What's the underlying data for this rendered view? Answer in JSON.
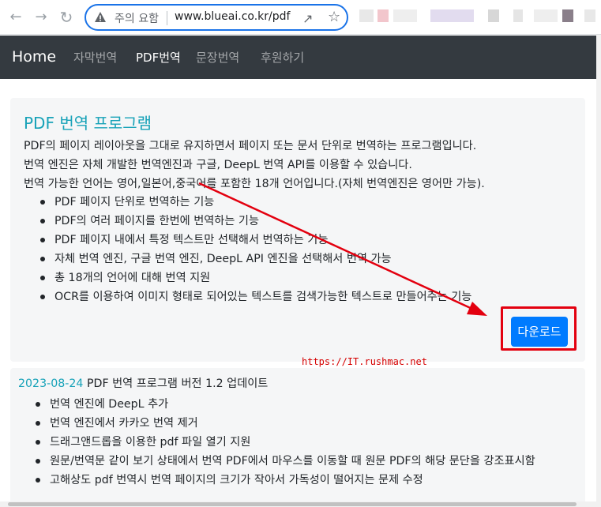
{
  "browser": {
    "security_text": "주의 요함",
    "url": "www.blueai.co.kr/pdf"
  },
  "navbar": {
    "brand": "Home",
    "links": [
      "자막번역",
      "PDF번역",
      "문장번역",
      "후원하기"
    ]
  },
  "main": {
    "title_prefix": "PDF",
    "title_rest": " 번역 프로그램",
    "paragraphs": [
      "PDF의 페이지 레이아웃을 그대로 유지하면서 페이지 또는 문서 단위로 번역하는 프로그램입니다.",
      "번역 엔진은 자체 개발한 번역엔진과 구글, DeepL 번역 API를 이용할 수 있습니다.",
      "번역 가능한 언어는 영어,일본어,중국어를 포함한 18개 언어입니다.(자체 번역엔진은 영어만 가능)."
    ],
    "features": [
      "PDF 페이지 단위로 번역하는 기능",
      "PDF의 여러 페이지를 한번에 번역하는 기능",
      "PDF 페이지 내에서 특정 텍스트만 선택해서 번역하는 기능",
      "자체 번역 엔진, 구글 번역 엔진, DeepL API 엔진을 선택해서 번역 가능",
      "총 18개의 언어에 대해 번역 지원",
      "OCR를 이용하여 이미지 형태로 되어있는 텍스트를 검색가능한 텍스트로 만들어주는 기능"
    ],
    "download_label": "다운로드"
  },
  "watermark": "https://IT.rushmac.net",
  "update": {
    "date": "2023-08-24",
    "title": " PDF 번역 프로그램 버전 1.2 업데이트",
    "items": [
      "번역 엔진에 DeepL 추가",
      "번역 엔진에서 카카오 번역 제거",
      "드래그앤드롭을 이용한 pdf 파일 열기 지원",
      "원문/번역문 같이 보기 상태에서 번역 PDF에서 마우스를 이동할 때 원문 PDF의 해당 문단을 강조표시함",
      "고해상도 pdf 번역시 번역 페이지의 크기가 작아서 가독성이 떨어지는 문제 수정"
    ]
  },
  "colors": {
    "accent": "#17a2b8",
    "navbar_bg": "#343a40",
    "button_bg": "#007bff",
    "highlight": "#e3000f"
  },
  "icons": [
    "back-arrow-icon",
    "forward-arrow-icon",
    "warning-icon",
    "share-icon",
    "star-icon"
  ]
}
